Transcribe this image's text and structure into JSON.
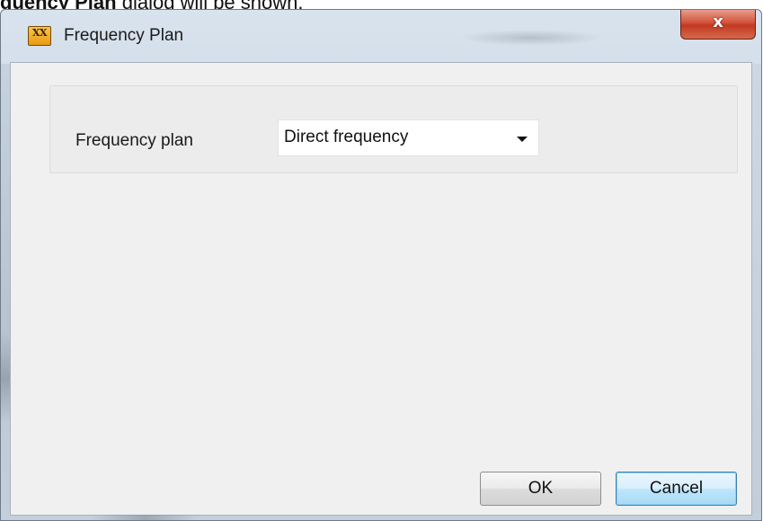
{
  "document": {
    "caption_bold": "quency Plan",
    "caption_rest": " dialog will be shown."
  },
  "window": {
    "title": "Frequency Plan",
    "app_icon_text": "XX",
    "close_glyph": "x"
  },
  "form": {
    "frequency_plan_label": "Frequency plan",
    "frequency_plan_value": "Direct frequency"
  },
  "buttons": {
    "ok_label": "OK",
    "cancel_label": "Cancel"
  },
  "colors": {
    "close_button": "#c23a22",
    "default_button_border": "#3c7fb1",
    "client_bg": "#f0f0f0"
  }
}
